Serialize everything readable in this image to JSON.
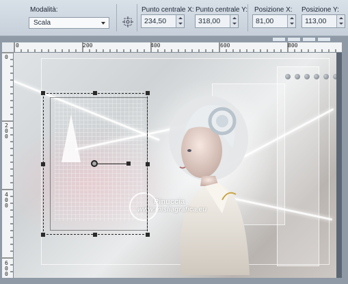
{
  "toolbar": {
    "mode_label": "Modalità:",
    "mode_value": "Scala",
    "center_x_label": "Punto centrale X:",
    "center_x_value": "234,50",
    "center_y_label": "Punto centrale Y:",
    "center_y_value": "318,00",
    "pos_x_label": "Posizione X:",
    "pos_x_value": "81,00",
    "pos_y_label": "Posizione Y:",
    "pos_y_value": "113,00"
  },
  "ruler": {
    "top_ticks": [
      "0",
      "200",
      "400",
      "600",
      "800"
    ],
    "left_ticks": [
      "0",
      "200",
      "400",
      "600"
    ]
  },
  "watermark": {
    "line1": "Pinuccia",
    "line2": "www.misliagrafica.eu"
  },
  "colors": {
    "toolbar_bg": "#cfd8e1",
    "canvas_bg": "#8f9aa6",
    "ruler_bg": "#f2f4f6"
  },
  "icons": {
    "center": "crosshair-target-icon",
    "spin": "spin-arrows-icon"
  }
}
